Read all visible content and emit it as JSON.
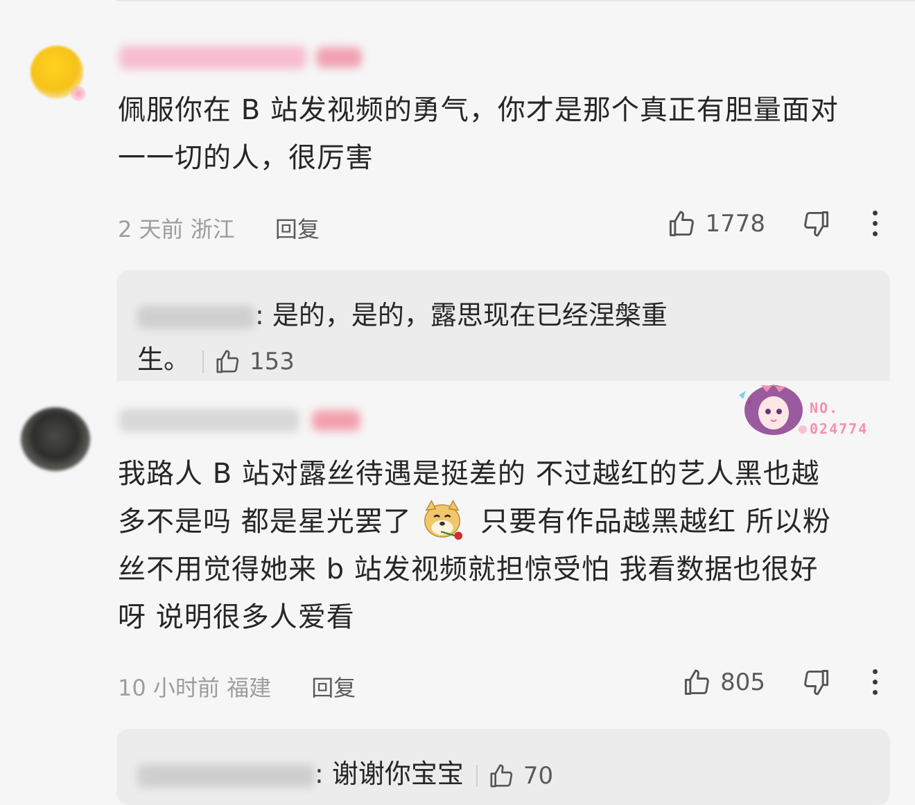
{
  "comments": [
    {
      "text_line1": "佩服你在 B 站发视频的勇气，你才是那个真正有胆量面对",
      "text_line2": "一一切的人，很厉害",
      "time": "2 天前",
      "location": "浙江",
      "reply_label": "回复",
      "likes": "1778",
      "reply": {
        "text_line1": ": 是的，是的，露思现在已经涅槃重",
        "text_line2": "生。",
        "likes": "153"
      }
    },
    {
      "text_line1": "我路人 B 站对露丝待遇是挺差的 不过越红的艺人黑也越",
      "text_line2a": "多不是吗 都是星光罢了",
      "text_line2b": " 只要有作品越黑越红 所以粉",
      "text_line3": "丝不用觉得她来 b 站发视频就担惊受怕  我看数据也很好",
      "text_line4": "呀 说明很多人爱看",
      "time": "10 小时前",
      "location": "福建",
      "reply_label": "回复",
      "likes": "805",
      "reply": {
        "text": ": 谢谢你宝宝",
        "likes": "70"
      }
    }
  ],
  "sticker": {
    "line1": "NO.",
    "line2": "024774"
  },
  "colors": {
    "background": "#f6f6f6",
    "reply_bg": "#ececec",
    "meta_text": "#9d9d9d",
    "accent_pink": "#f58fb0"
  }
}
